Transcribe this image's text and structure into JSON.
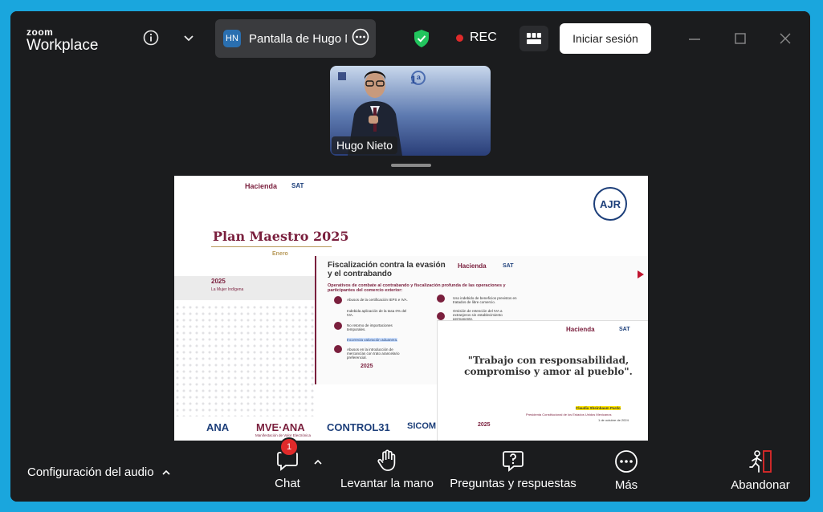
{
  "app": {
    "logo_line1": "zoom",
    "logo_line2": "Workplace"
  },
  "titlebar": {
    "share_initials": "HN",
    "share_title": "Pantalla de Hugo N",
    "rec_label": "REC",
    "signin_label": "Iniciar sesión"
  },
  "video": {
    "participant_name": "Hugo Nieto"
  },
  "slide": {
    "header_brand": "Hacienda",
    "header_sat": "SAT",
    "ajr_logo": "AJR",
    "title": "Plan Maestro 2025",
    "subtitle": "Enero",
    "year_badge": "2025",
    "year_caption": "La Mujer Indígena",
    "inner1_title": "Fiscalización contra la evasión y el contrabando",
    "inner1_bullet": "Operativos de combate al contrabando y fiscalización profunda de las operaciones y participantes del comercio exterior:",
    "inner1_items": [
      "Abusos de la certificación IEPS e IVA.",
      "Indebida aplicación de la tasa 0% del IVA.",
      "No retorno de importaciones temporales.",
      "Incorrecta valoración aduanera.",
      "Abusos en la introducción de mercancías con trato arancelario preferencial."
    ],
    "inner1_items_right": [
      "Uso indebido de beneficios previstos en tratados de libre comercio.",
      "Omisión de retención del IVA a extranjeros sin establecimiento permanente."
    ],
    "quote": "\"Trabajo con responsabilidad, compromiso y amor al pueblo\".",
    "quote_author": "Claudia Sheinbaum Pardo",
    "quote_role": "Presidenta Constitucional de los Estados Unidos Mexicanos",
    "quote_date": "1 de octubre de 2024",
    "footer_logos": [
      "ANA",
      "MVE·ANA",
      "CONTROL31",
      "SICOM"
    ],
    "footer_mve_caption": "Manifestación de Valor Electrónica"
  },
  "toolbar": {
    "audio_label": "Configuración del audio",
    "chat_label": "Chat",
    "chat_badge": "1",
    "raise_hand_label": "Levantar la mano",
    "qa_label": "Preguntas y respuestas",
    "more_label": "Más",
    "leave_label": "Abandonar"
  },
  "colors": {
    "accent": "#1aa6dd",
    "rec_dot": "#e02a2a",
    "window_bg": "#1b1c1e",
    "slide_title": "#7a1f3d",
    "shield": "#22c55e"
  }
}
